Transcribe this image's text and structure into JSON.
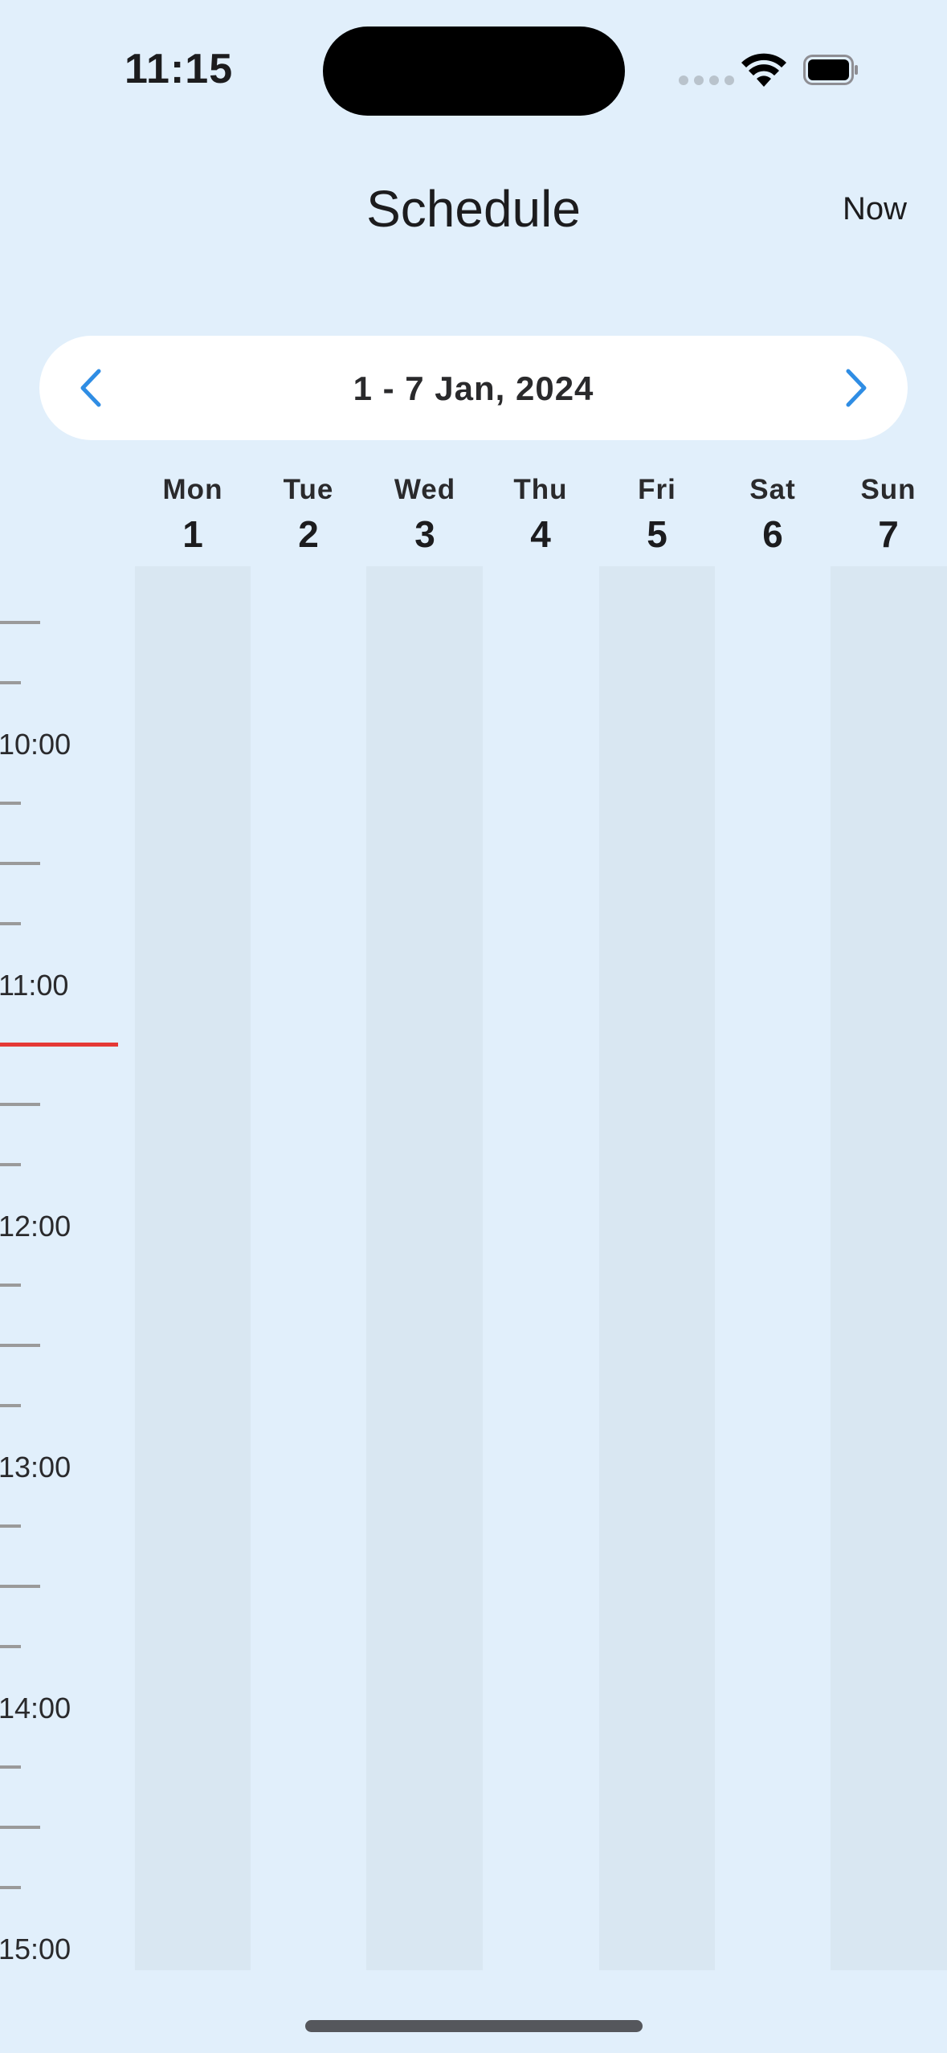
{
  "status_bar": {
    "time": "11:15",
    "wifi_icon": "wifi-icon",
    "battery_icon": "battery-full-icon",
    "signal_icon": "cellular-signal-icon"
  },
  "header": {
    "title": "Schedule",
    "now_label": "Now"
  },
  "week_picker": {
    "label": "1 - 7 Jan, 2024",
    "prev_icon": "chevron-left-icon",
    "next_icon": "chevron-right-icon",
    "accent_color": "#2f8de4"
  },
  "days": [
    {
      "name": "Mon",
      "num": "1"
    },
    {
      "name": "Tue",
      "num": "2"
    },
    {
      "name": "Wed",
      "num": "3"
    },
    {
      "name": "Thu",
      "num": "4"
    },
    {
      "name": "Fri",
      "num": "5"
    },
    {
      "name": "Sat",
      "num": "6"
    },
    {
      "name": "Sun",
      "num": "7"
    }
  ],
  "hours": [
    "10:00",
    "11:00",
    "12:00",
    "13:00",
    "14:00",
    "15:00"
  ],
  "current_time_indicator_color": "#e53935"
}
